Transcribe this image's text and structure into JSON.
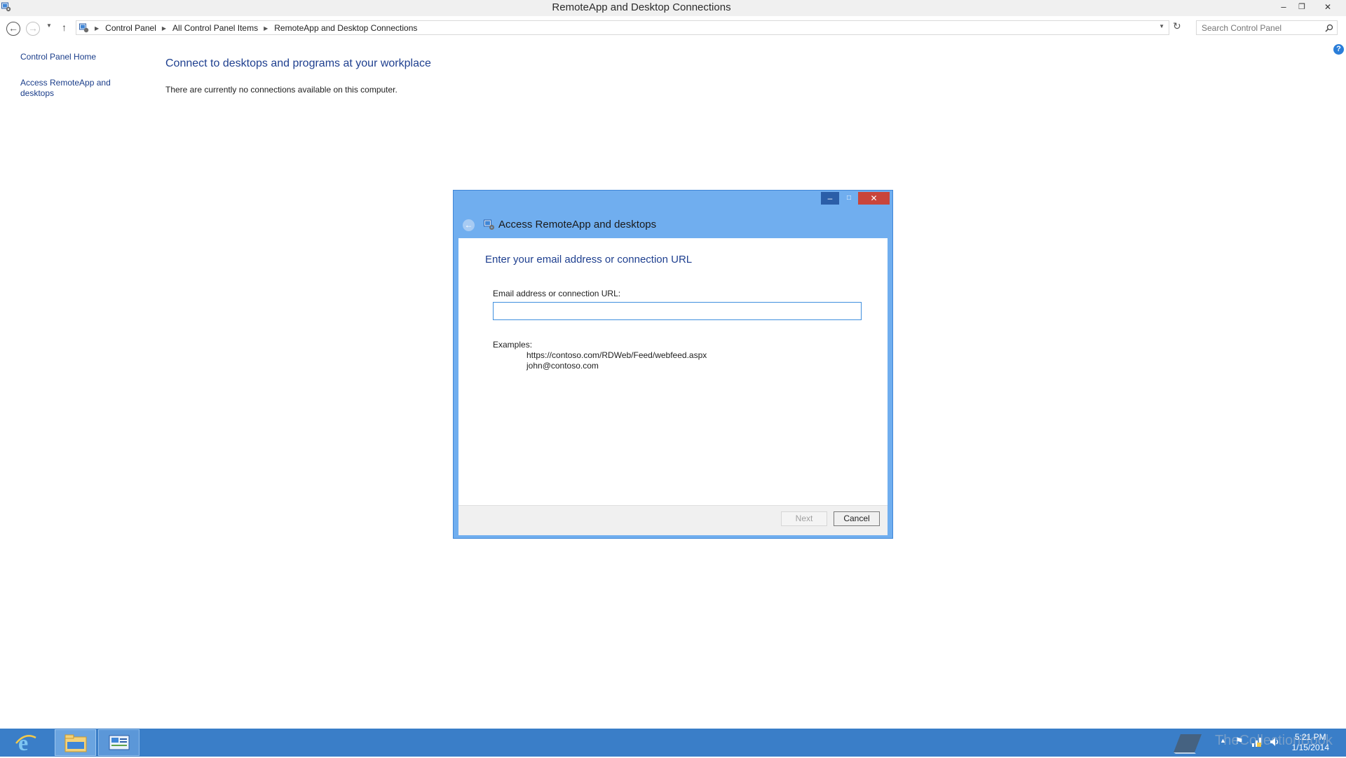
{
  "window": {
    "title": "RemoteApp and Desktop Connections",
    "minimize_glyph": "–",
    "restore_glyph": "❐",
    "close_glyph": "✕"
  },
  "addressbar": {
    "crumbs": [
      "Control Panel",
      "All Control Panel Items",
      "RemoteApp and Desktop Connections"
    ],
    "search_placeholder": "Search Control Panel"
  },
  "sidebar": {
    "items": [
      {
        "label": "Control Panel Home"
      },
      {
        "label_line1": "Access RemoteApp and",
        "label_line2": "desktops"
      }
    ]
  },
  "main": {
    "heading": "Connect to desktops and programs at your workplace",
    "status": "There are currently no connections available on this computer."
  },
  "dialog": {
    "title": "Access RemoteApp and desktops",
    "instruction": "Enter your email address or connection URL",
    "field_label": "Email address or connection URL:",
    "field_value": "",
    "examples_heading": "Examples:",
    "examples": [
      "https://contoso.com/RDWeb/Feed/webfeed.aspx",
      "john@contoso.com"
    ],
    "next_label": "Next",
    "cancel_label": "Cancel",
    "next_enabled": false
  },
  "taskbar": {
    "pinned": [
      "internet-explorer",
      "file-explorer",
      "control-panel"
    ],
    "time": "5:21 PM",
    "date": "1/15/2014",
    "watermark": "TheCollectionBook"
  },
  "colors": {
    "accent": "#3a7ec8",
    "dialog_frame": "#70aeef",
    "link": "#1a3d8a",
    "heading": "#1e3f8f"
  }
}
